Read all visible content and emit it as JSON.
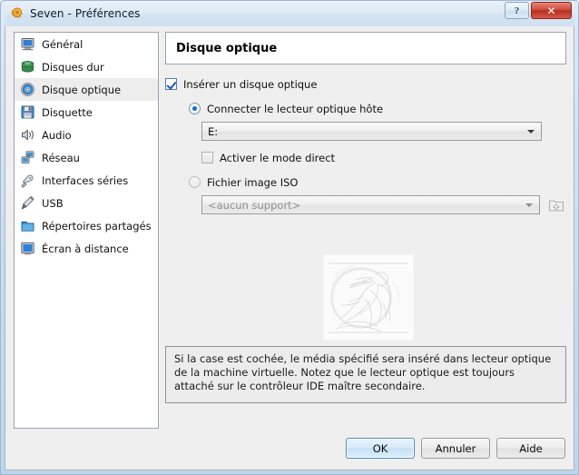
{
  "window": {
    "title": "Seven - Préférences",
    "app_icon": "gear-icon",
    "buttons": {
      "help": "?",
      "close": "✕"
    }
  },
  "sidebar": {
    "items": [
      {
        "label": "Général",
        "icon": "monitor-icon",
        "selected": false
      },
      {
        "label": "Disques dur",
        "icon": "hard-disk-icon",
        "selected": false
      },
      {
        "label": "Disque optique",
        "icon": "optical-disc-icon",
        "selected": true
      },
      {
        "label": "Disquette",
        "icon": "floppy-disk-icon",
        "selected": false
      },
      {
        "label": "Audio",
        "icon": "speaker-icon",
        "selected": false
      },
      {
        "label": "Réseau",
        "icon": "network-icon",
        "selected": false
      },
      {
        "label": "Interfaces séries",
        "icon": "serial-port-icon",
        "selected": false
      },
      {
        "label": "USB",
        "icon": "usb-icon",
        "selected": false
      },
      {
        "label": "Répertoires partagés",
        "icon": "shared-folder-icon",
        "selected": false
      },
      {
        "label": "Écran à distance",
        "icon": "remote-display-icon",
        "selected": false
      }
    ]
  },
  "panel": {
    "title": "Disque optique",
    "insert_checkbox": {
      "label": "Insérer un disque optique",
      "checked": true
    },
    "host_drive_radio": {
      "label": "Connecter le lecteur optique hôte",
      "selected": true
    },
    "host_drive_combo": {
      "value": "E:",
      "enabled": true
    },
    "passthrough_checkbox": {
      "label": "Activer le mode direct",
      "checked": false
    },
    "iso_radio": {
      "label": "Fichier image ISO",
      "selected": false
    },
    "iso_combo": {
      "value": "<aucun support>",
      "enabled": false
    },
    "browse_button": {
      "icon": "open-folder-icon",
      "enabled": false
    },
    "preview_image": "embossed-engraving-illustration",
    "help_text": "Si la case est cochée, le média spécifié sera inséré dans lecteur optique de la machine virtuelle. Notez que le lecteur optique est toujours attaché sur le contrôleur IDE maître secondaire."
  },
  "footer": {
    "ok": "OK",
    "cancel": "Annuler",
    "help": "Aide"
  },
  "colors": {
    "accent": "#1b6fc0",
    "close_button": "#cf4b3c",
    "panel_bg": "#efefef",
    "sidebar_bg": "#ffffff"
  }
}
